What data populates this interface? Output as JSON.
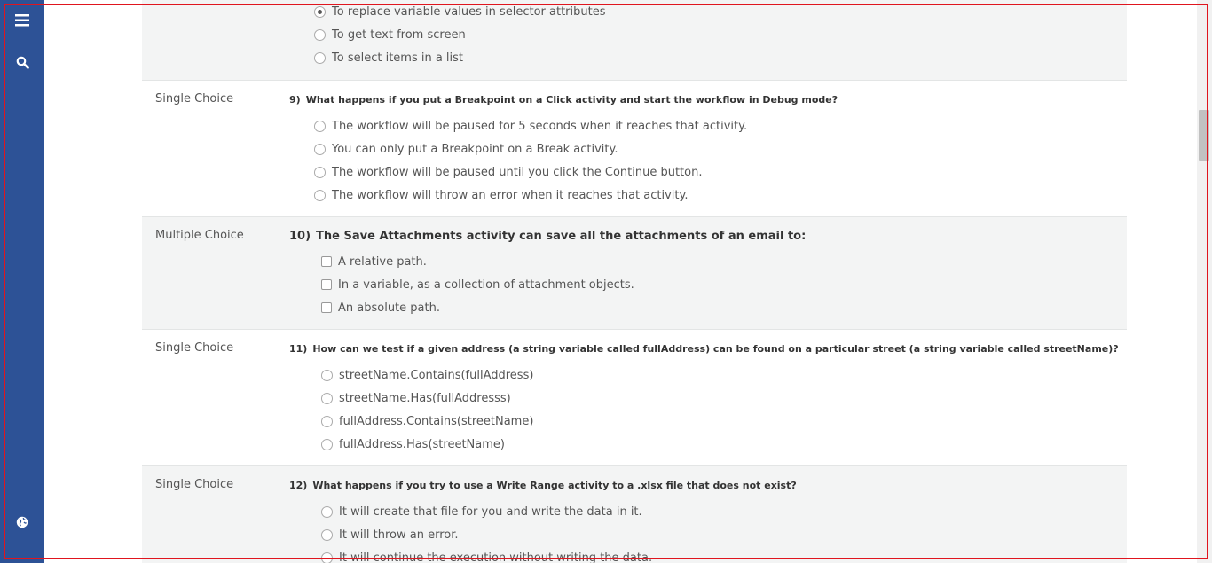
{
  "sidebar": {
    "icons": [
      {
        "name": "menu-icon"
      },
      {
        "name": "search-icon"
      },
      {
        "name": "globe-icon"
      }
    ]
  },
  "questions": {
    "q8": {
      "options": [
        {
          "label": "To replace variable values in selector attributes",
          "selected": true
        },
        {
          "label": "To get text from screen",
          "selected": false
        },
        {
          "label": "To select items in a list",
          "selected": false
        }
      ]
    },
    "q9": {
      "type": "Single Choice",
      "number": "9)",
      "text": "What happens if you put a Breakpoint on a Click activity and start the workflow in Debug mode?",
      "options": [
        {
          "label": "The workflow will be paused for 5 seconds when it reaches that activity."
        },
        {
          "label": "You can only put a Breakpoint on a Break activity."
        },
        {
          "label": "The workflow will be paused until you click the Continue button."
        },
        {
          "label": "The workflow will throw an error when it reaches that activity."
        }
      ]
    },
    "q10": {
      "type": "Multiple Choice",
      "number": "10)",
      "text": "The Save Attachments activity can save all the attachments of an email to:",
      "options": [
        {
          "label": "A relative path."
        },
        {
          "label": "In a variable, as a collection of attachment objects."
        },
        {
          "label": "An absolute path."
        }
      ]
    },
    "q11": {
      "type": "Single Choice",
      "number": "11)",
      "text": "How can we test if a given address (a string variable called fullAddress) can be found on a particular street (a string variable called streetName)?",
      "options": [
        {
          "label": "streetName.Contains(fullAddress)"
        },
        {
          "label": "streetName.Has(fullAddresss)"
        },
        {
          "label": "fullAddress.Contains(streetName)"
        },
        {
          "label": "fullAddress.Has(streetName)"
        }
      ]
    },
    "q12": {
      "type": "Single Choice",
      "number": "12)",
      "text": "What happens if you try to use a Write Range activity to a .xlsx file that does not exist?",
      "options": [
        {
          "label": "It will create that file for you and write the data in it."
        },
        {
          "label": "It will throw an error."
        },
        {
          "label": "It will continue the execution without writing the data."
        }
      ]
    }
  }
}
